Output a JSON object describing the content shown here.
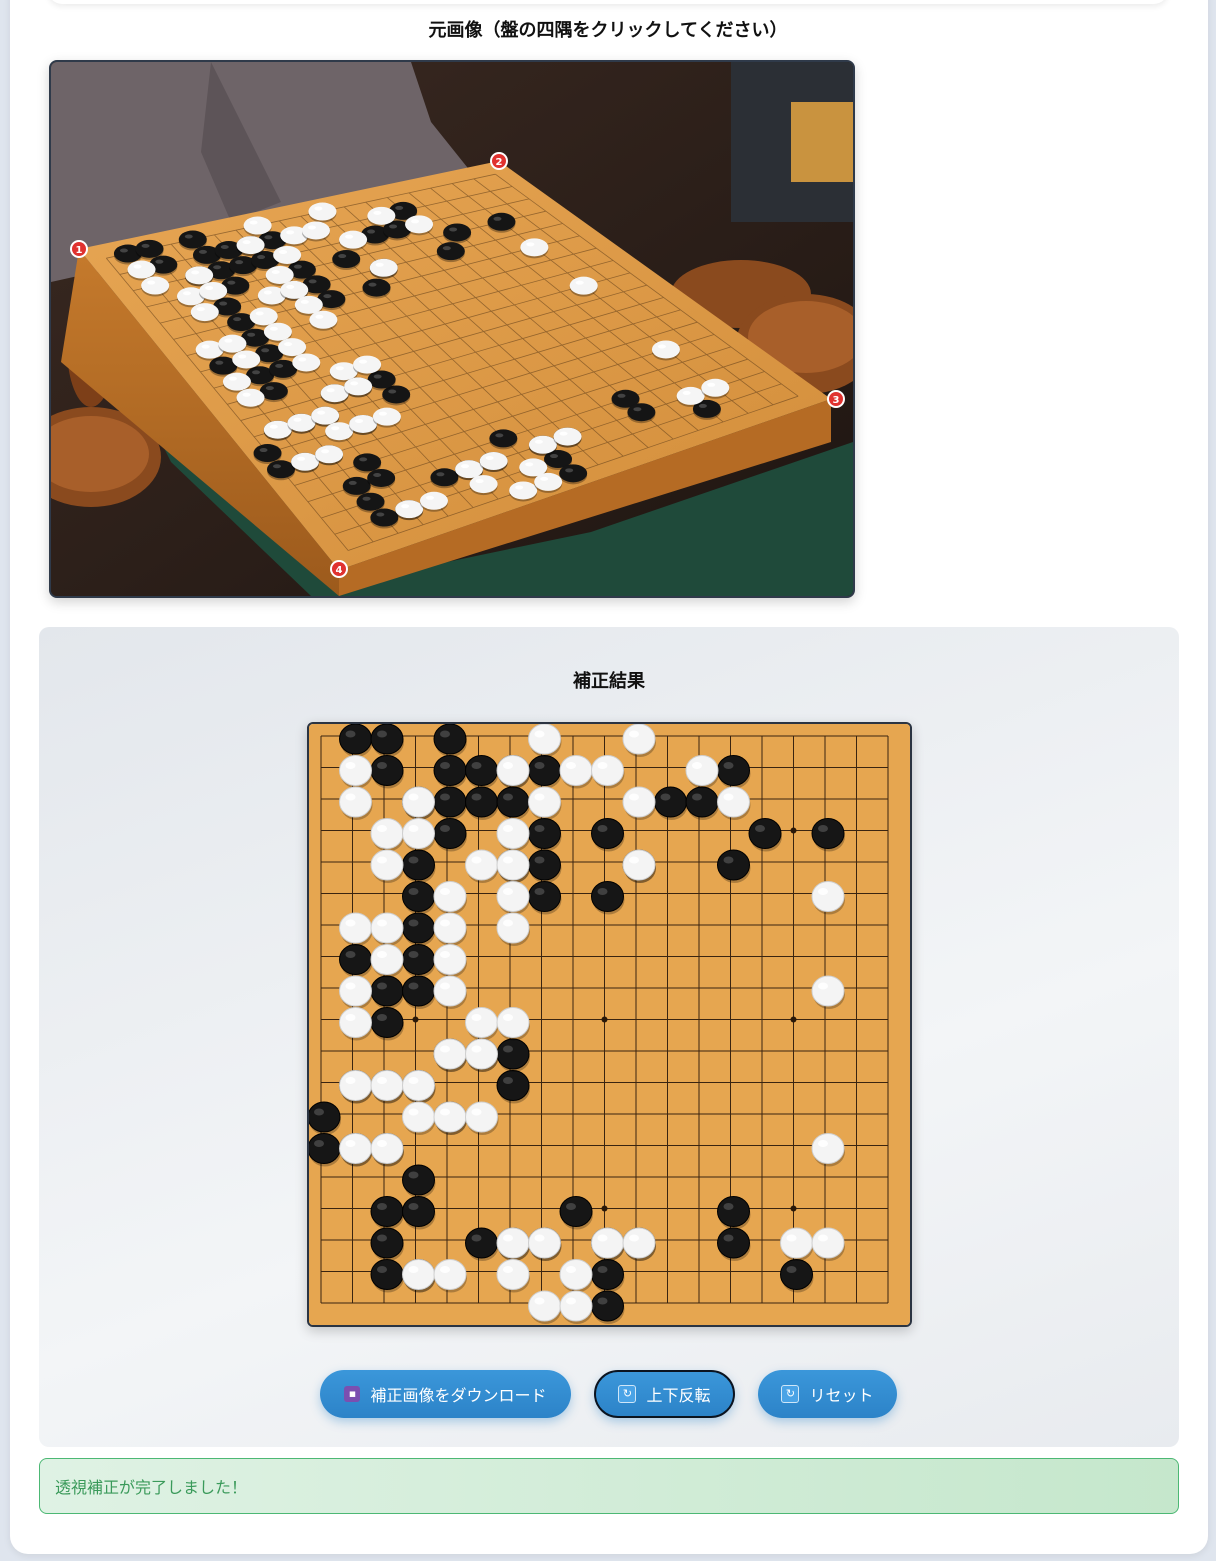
{
  "original": {
    "title": "元画像（盤の四隅をクリックしてください）",
    "corner_markers": [
      "1",
      "2",
      "3",
      "4"
    ]
  },
  "result": {
    "title": "補正結果"
  },
  "buttons": {
    "download": {
      "label": "補正画像をダウンロード",
      "icon": "floppy-disk-icon"
    },
    "flip": {
      "label": "上下反転",
      "icon": "refresh-icon"
    },
    "reset": {
      "label": "リセット",
      "icon": "refresh-icon"
    }
  },
  "status": {
    "message": "透視補正が完了しました！"
  },
  "colors": {
    "accent": "#2c83c8",
    "success_text": "#3a9a5a",
    "success_border": "#4cb874",
    "board_wood": "#e3a44d"
  }
}
